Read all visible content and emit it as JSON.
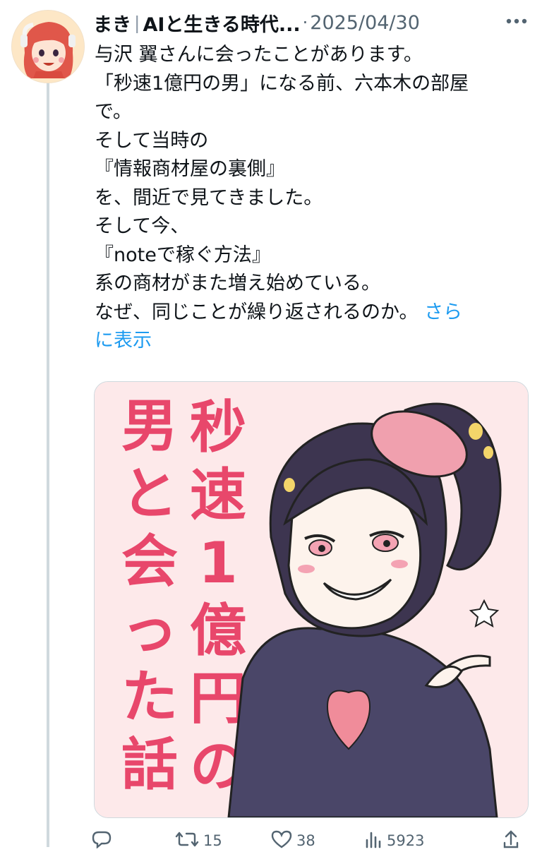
{
  "tweet": {
    "author_name": "まき",
    "author_separator": "|",
    "author_subtitle": "AIと生きる時代...",
    "dot": "·",
    "date": "2025/04/30",
    "lines": [
      "与沢 翼さんに会ったことがあります。",
      "「秒速1億円の男」になる前、六本木の部屋",
      "で。",
      "そして当時の",
      "『情報商材屋の裏側』",
      "を、間近で見てきました。",
      "そして今、",
      "『noteで稼ぐ方法』",
      "系の商材がまた増え始めている。",
      "なぜ、同じことが繰り返されるのか。"
    ],
    "show_more_1": "さら",
    "show_more_2": "に表示"
  },
  "media": {
    "title_col_right": "秒速1億円の",
    "title_col_left": "男と会った話",
    "accent_color": "#e8476b"
  },
  "actions": {
    "reply_count": "",
    "retweet_count": "15",
    "like_count": "38",
    "views_count": "5923"
  },
  "icons": [
    "more-icon",
    "reply-icon",
    "retweet-icon",
    "like-icon",
    "views-icon",
    "share-icon"
  ]
}
